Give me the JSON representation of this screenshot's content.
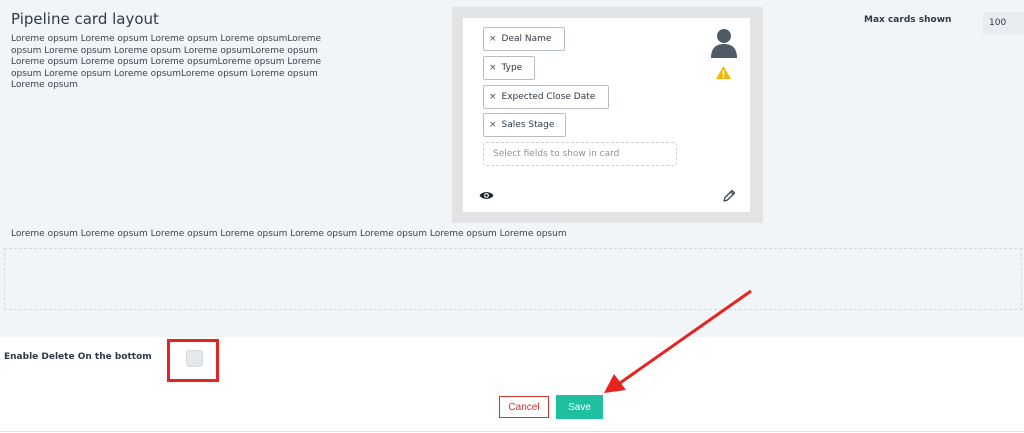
{
  "section": {
    "title": "Pipeline card layout",
    "description": "Loreme opsum Loreme opsum Loreme opsum Loreme opsumLoreme opsum Loreme opsum Loreme opsum Loreme opsumLoreme opsum Loreme opsum Loreme opsum Loreme opsumLoreme opsum Loreme opsum Loreme opsum Loreme opsumLoreme opsum Loreme opsum Loreme opsum"
  },
  "card": {
    "fields": [
      {
        "label": "Deal Name"
      },
      {
        "label": "Type"
      },
      {
        "label": "Expected Close Date"
      },
      {
        "label": "Sales Stage"
      }
    ],
    "remove_glyph": "×",
    "select_placeholder": "Select fields to show in card",
    "icons": [
      "avatar-icon",
      "warning-icon",
      "eye-icon",
      "pencil-icon"
    ]
  },
  "max_cards": {
    "label": "Max cards shown",
    "value": "100"
  },
  "description2": "Loreme opsum Loreme opsum Loreme opsum Loreme opsum Loreme opsum Loreme opsum Loreme opsum Loreme opsum",
  "enable_delete": {
    "label": "Enable Delete On the bottom",
    "checked": false
  },
  "actions": {
    "cancel_label": "Cancel",
    "save_label": "Save"
  },
  "colors": {
    "panel_bg": "#f2f5f8",
    "save_bg": "#1fc0a0",
    "cancel": "#d0332f",
    "annotation_red": "#e8231f",
    "warning": "#f2b705"
  }
}
